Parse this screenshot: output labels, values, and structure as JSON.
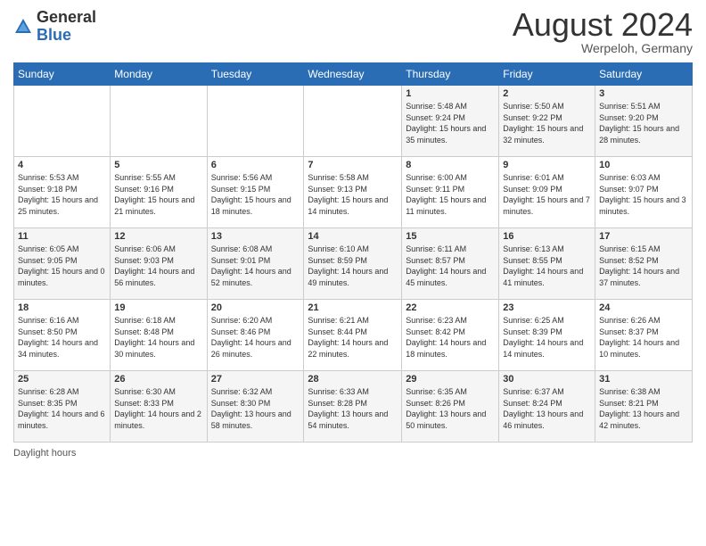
{
  "header": {
    "logo_general": "General",
    "logo_blue": "Blue",
    "month_title": "August 2024",
    "location": "Werpeloh, Germany"
  },
  "days_of_week": [
    "Sunday",
    "Monday",
    "Tuesday",
    "Wednesday",
    "Thursday",
    "Friday",
    "Saturday"
  ],
  "weeks": [
    [
      {
        "day": "",
        "info": ""
      },
      {
        "day": "",
        "info": ""
      },
      {
        "day": "",
        "info": ""
      },
      {
        "day": "",
        "info": ""
      },
      {
        "day": "1",
        "info": "Sunrise: 5:48 AM\nSunset: 9:24 PM\nDaylight: 15 hours\nand 35 minutes."
      },
      {
        "day": "2",
        "info": "Sunrise: 5:50 AM\nSunset: 9:22 PM\nDaylight: 15 hours\nand 32 minutes."
      },
      {
        "day": "3",
        "info": "Sunrise: 5:51 AM\nSunset: 9:20 PM\nDaylight: 15 hours\nand 28 minutes."
      }
    ],
    [
      {
        "day": "4",
        "info": "Sunrise: 5:53 AM\nSunset: 9:18 PM\nDaylight: 15 hours\nand 25 minutes."
      },
      {
        "day": "5",
        "info": "Sunrise: 5:55 AM\nSunset: 9:16 PM\nDaylight: 15 hours\nand 21 minutes."
      },
      {
        "day": "6",
        "info": "Sunrise: 5:56 AM\nSunset: 9:15 PM\nDaylight: 15 hours\nand 18 minutes."
      },
      {
        "day": "7",
        "info": "Sunrise: 5:58 AM\nSunset: 9:13 PM\nDaylight: 15 hours\nand 14 minutes."
      },
      {
        "day": "8",
        "info": "Sunrise: 6:00 AM\nSunset: 9:11 PM\nDaylight: 15 hours\nand 11 minutes."
      },
      {
        "day": "9",
        "info": "Sunrise: 6:01 AM\nSunset: 9:09 PM\nDaylight: 15 hours\nand 7 minutes."
      },
      {
        "day": "10",
        "info": "Sunrise: 6:03 AM\nSunset: 9:07 PM\nDaylight: 15 hours\nand 3 minutes."
      }
    ],
    [
      {
        "day": "11",
        "info": "Sunrise: 6:05 AM\nSunset: 9:05 PM\nDaylight: 15 hours\nand 0 minutes."
      },
      {
        "day": "12",
        "info": "Sunrise: 6:06 AM\nSunset: 9:03 PM\nDaylight: 14 hours\nand 56 minutes."
      },
      {
        "day": "13",
        "info": "Sunrise: 6:08 AM\nSunset: 9:01 PM\nDaylight: 14 hours\nand 52 minutes."
      },
      {
        "day": "14",
        "info": "Sunrise: 6:10 AM\nSunset: 8:59 PM\nDaylight: 14 hours\nand 49 minutes."
      },
      {
        "day": "15",
        "info": "Sunrise: 6:11 AM\nSunset: 8:57 PM\nDaylight: 14 hours\nand 45 minutes."
      },
      {
        "day": "16",
        "info": "Sunrise: 6:13 AM\nSunset: 8:55 PM\nDaylight: 14 hours\nand 41 minutes."
      },
      {
        "day": "17",
        "info": "Sunrise: 6:15 AM\nSunset: 8:52 PM\nDaylight: 14 hours\nand 37 minutes."
      }
    ],
    [
      {
        "day": "18",
        "info": "Sunrise: 6:16 AM\nSunset: 8:50 PM\nDaylight: 14 hours\nand 34 minutes."
      },
      {
        "day": "19",
        "info": "Sunrise: 6:18 AM\nSunset: 8:48 PM\nDaylight: 14 hours\nand 30 minutes."
      },
      {
        "day": "20",
        "info": "Sunrise: 6:20 AM\nSunset: 8:46 PM\nDaylight: 14 hours\nand 26 minutes."
      },
      {
        "day": "21",
        "info": "Sunrise: 6:21 AM\nSunset: 8:44 PM\nDaylight: 14 hours\nand 22 minutes."
      },
      {
        "day": "22",
        "info": "Sunrise: 6:23 AM\nSunset: 8:42 PM\nDaylight: 14 hours\nand 18 minutes."
      },
      {
        "day": "23",
        "info": "Sunrise: 6:25 AM\nSunset: 8:39 PM\nDaylight: 14 hours\nand 14 minutes."
      },
      {
        "day": "24",
        "info": "Sunrise: 6:26 AM\nSunset: 8:37 PM\nDaylight: 14 hours\nand 10 minutes."
      }
    ],
    [
      {
        "day": "25",
        "info": "Sunrise: 6:28 AM\nSunset: 8:35 PM\nDaylight: 14 hours\nand 6 minutes."
      },
      {
        "day": "26",
        "info": "Sunrise: 6:30 AM\nSunset: 8:33 PM\nDaylight: 14 hours\nand 2 minutes."
      },
      {
        "day": "27",
        "info": "Sunrise: 6:32 AM\nSunset: 8:30 PM\nDaylight: 13 hours\nand 58 minutes."
      },
      {
        "day": "28",
        "info": "Sunrise: 6:33 AM\nSunset: 8:28 PM\nDaylight: 13 hours\nand 54 minutes."
      },
      {
        "day": "29",
        "info": "Sunrise: 6:35 AM\nSunset: 8:26 PM\nDaylight: 13 hours\nand 50 minutes."
      },
      {
        "day": "30",
        "info": "Sunrise: 6:37 AM\nSunset: 8:24 PM\nDaylight: 13 hours\nand 46 minutes."
      },
      {
        "day": "31",
        "info": "Sunrise: 6:38 AM\nSunset: 8:21 PM\nDaylight: 13 hours\nand 42 minutes."
      }
    ]
  ],
  "footer": {
    "daylight_label": "Daylight hours"
  }
}
